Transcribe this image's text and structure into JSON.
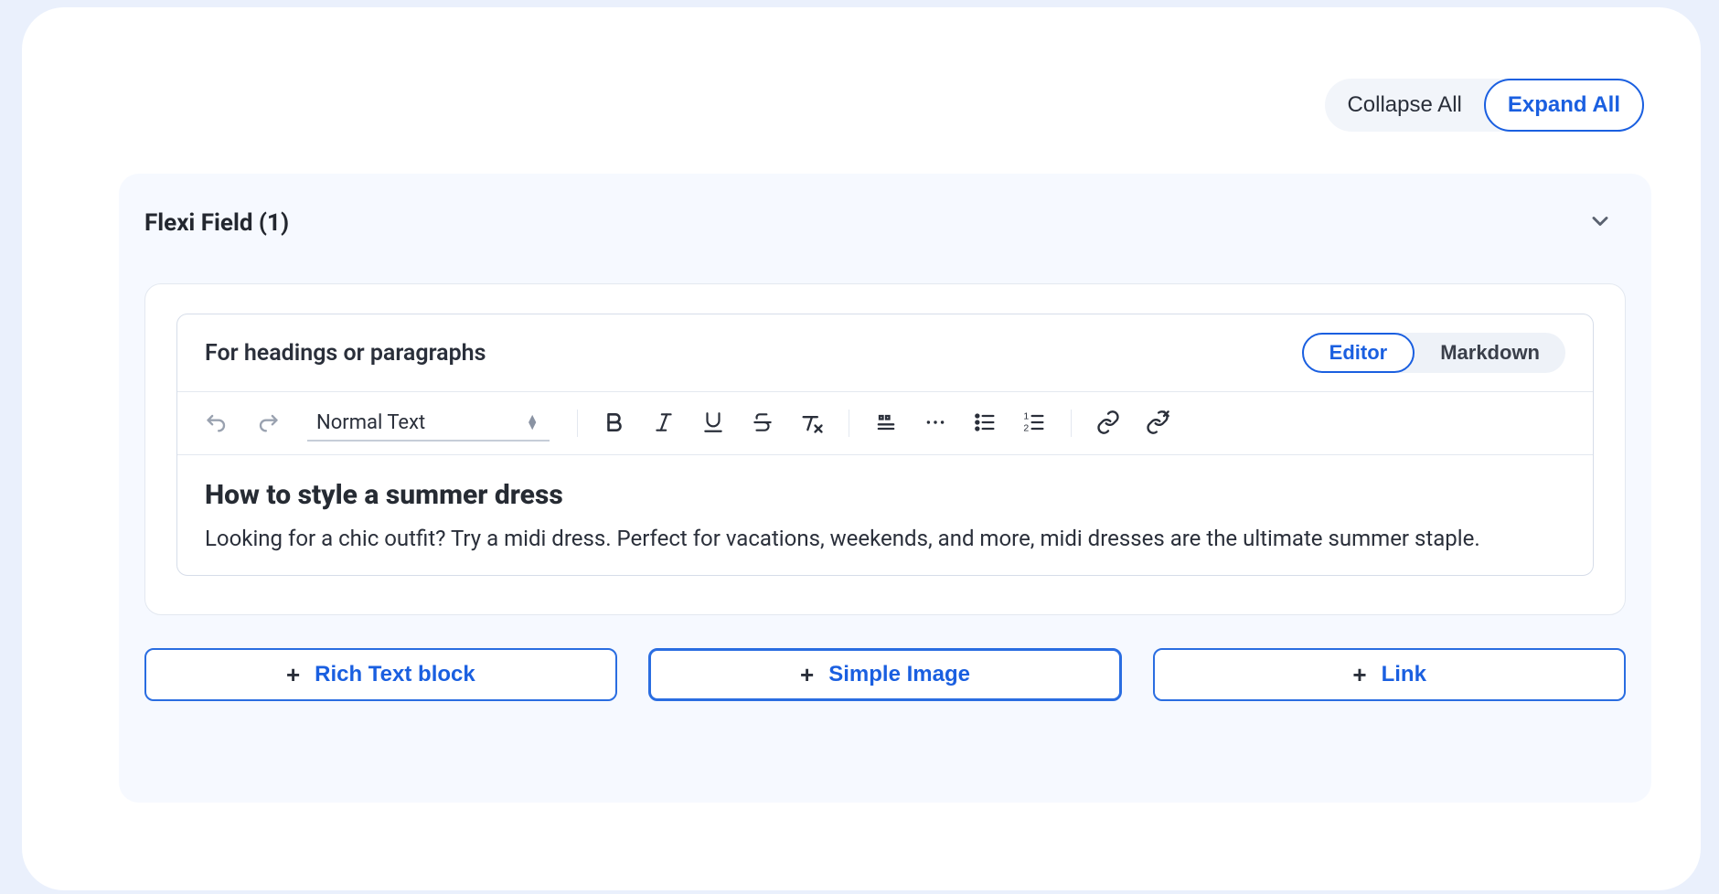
{
  "top": {
    "collapse_label": "Collapse All",
    "expand_label": "Expand All"
  },
  "flexi": {
    "title": "Flexi Field (1)"
  },
  "editor": {
    "description": "For headings or paragraphs",
    "mode_editor": "Editor",
    "mode_markdown": "Markdown",
    "format_select": "Normal Text",
    "content": {
      "heading": "How to style a summer dress",
      "body": "Looking for a chic outfit? Try a midi dress. Perfect for vacations, weekends, and more, midi dresses are the ultimate summer staple."
    }
  },
  "blocks": {
    "rich_text": "Rich Text block",
    "simple_image": "Simple Image",
    "link": "Link"
  }
}
